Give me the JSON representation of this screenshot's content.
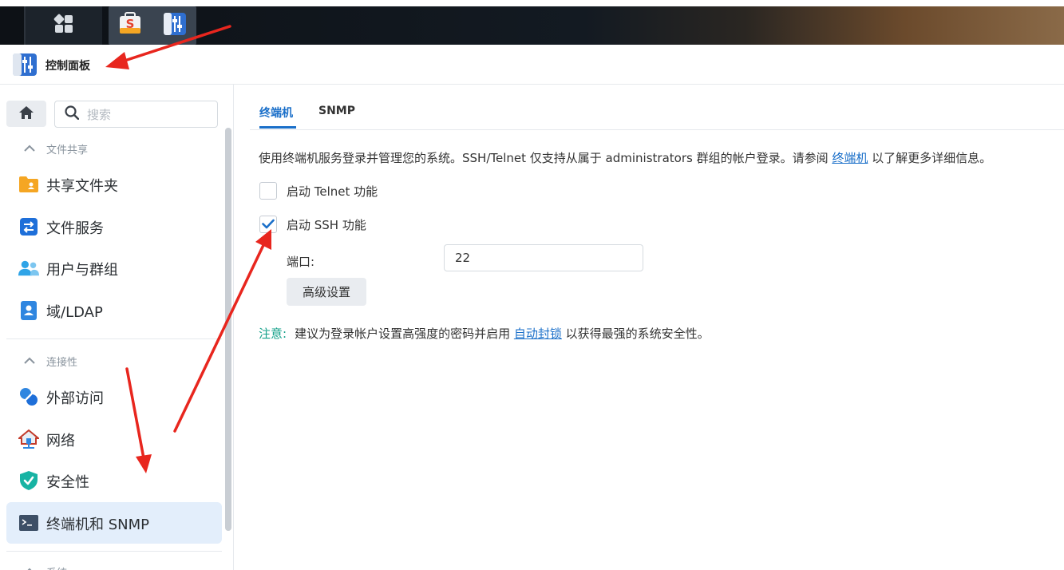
{
  "colors": {
    "accent": "#1a6fc9",
    "note": "#13a089",
    "annotation": "#e8261e",
    "active_nav_bg": "#e3eefb"
  },
  "taskbar": {
    "icons": [
      "main-menu-icon",
      "package-center-icon",
      "control-panel-icon"
    ]
  },
  "window": {
    "title": "控制面板",
    "icon": "control-panel-icon"
  },
  "sidebar": {
    "search_placeholder": "搜索",
    "sections": [
      {
        "title": "文件共享",
        "items": [
          {
            "label": "共享文件夹",
            "icon": "shared-folder-icon"
          },
          {
            "label": "文件服务",
            "icon": "file-services-icon"
          },
          {
            "label": "用户与群组",
            "icon": "users-groups-icon"
          },
          {
            "label": "域/LDAP",
            "icon": "domain-ldap-icon"
          }
        ]
      },
      {
        "title": "连接性",
        "items": [
          {
            "label": "外部访问",
            "icon": "external-access-icon"
          },
          {
            "label": "网络",
            "icon": "network-icon"
          },
          {
            "label": "安全性",
            "icon": "security-shield-icon"
          },
          {
            "label": "终端机和 SNMP",
            "icon": "terminal-icon",
            "active": true
          }
        ]
      },
      {
        "title": "系统",
        "items": []
      }
    ]
  },
  "main": {
    "tabs": [
      {
        "label": "终端机",
        "active": true
      },
      {
        "label": "SNMP",
        "active": false
      }
    ],
    "description": {
      "before_link": "使用终端机服务登录并管理您的系统。SSH/Telnet 仅支持从属于 administrators 群组的帐户登录。请参阅 ",
      "link": "终端机",
      "after_link": " 以了解更多详细信息。"
    },
    "telnet": {
      "label": "启动 Telnet 功能",
      "checked": false
    },
    "ssh": {
      "label": "启动 SSH 功能",
      "checked": true
    },
    "port": {
      "label": "端口:",
      "value": "22"
    },
    "advanced_button": "高级设置",
    "note": {
      "label": "注意:",
      "before_link": "建议为登录帐户设置高强度的密码并启用 ",
      "link": "自动封锁",
      "after_link": " 以获得最强的系统安全性。"
    }
  }
}
